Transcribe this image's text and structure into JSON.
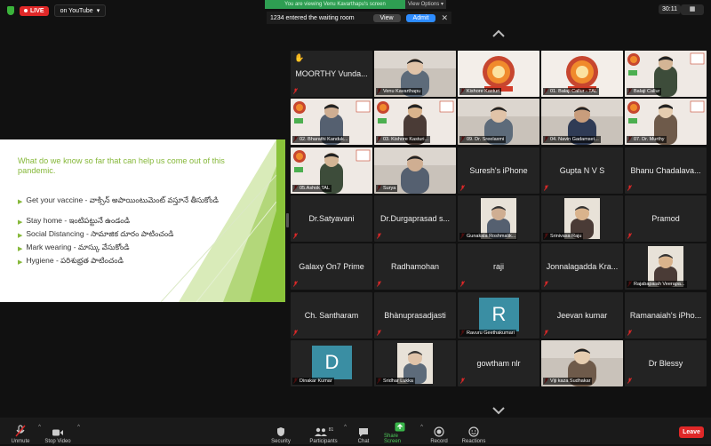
{
  "header": {
    "live_label": "LIVE",
    "youtube_label": "on YouTube",
    "viewing_banner": "You are viewing Venu Kavarthapu's screen",
    "view_options": "View Options",
    "timer": "30:11",
    "waiting": {
      "text": "1234 entered the waiting room",
      "view_label": "View",
      "admit_label": "Admit"
    }
  },
  "slide": {
    "title": "What do we know so far that can help us come out of this pandemic.",
    "items": [
      "Get your vaccine - వాక్సిన్ అపాయింటుమెంట్ వస్తూనే తీసుకోండి",
      "Stay home - ఇంటిపట్టునే ఉండండి",
      "Social Distancing - సామాజిక దూరం పాటించండి",
      "Mark wearing - మాస్కు వేసుకోండి",
      "Hygiene - పరిశుభ్రత పాటించండి"
    ]
  },
  "participants": [
    {
      "name": "MOORTHY Vunda...",
      "kind": "name",
      "hand": true
    },
    {
      "name": "Venu Kavarthapu",
      "kind": "video"
    },
    {
      "name": "Kishore Kasturi",
      "kind": "logo"
    },
    {
      "name": "01. Balaji Callur - TAL",
      "kind": "logo"
    },
    {
      "name": "Balaji Callur",
      "kind": "video"
    },
    {
      "name": "02. Bharathi Kanduk...",
      "kind": "video"
    },
    {
      "name": "03. Kishore Kasturi...",
      "kind": "video"
    },
    {
      "name": "09. Dr. Sreelaxmi",
      "kind": "video"
    },
    {
      "name": "04. Navin Gadamset...",
      "kind": "video"
    },
    {
      "name": "07. Dr. Murthy",
      "kind": "video"
    },
    {
      "name": "05.Ashok TAL",
      "kind": "video"
    },
    {
      "name": "Surya",
      "kind": "video"
    },
    {
      "name": "Suresh's iPhone",
      "kind": "name"
    },
    {
      "name": "Gupta N V S",
      "kind": "name"
    },
    {
      "name": "Bhanu Chadalava...",
      "kind": "name"
    },
    {
      "name": "Dr.Satyavani",
      "kind": "name"
    },
    {
      "name": "Dr.Durgaprasad s...",
      "kind": "name"
    },
    {
      "name": "Gunakala Roshmalik...",
      "kind": "photo"
    },
    {
      "name": "Srinivasa Raju",
      "kind": "photo"
    },
    {
      "name": "Pramod",
      "kind": "name"
    },
    {
      "name": "Galaxy On7 Prime",
      "kind": "name"
    },
    {
      "name": "Radhamohan",
      "kind": "name"
    },
    {
      "name": "raji",
      "kind": "name"
    },
    {
      "name": "Jonnalagadda Kra...",
      "kind": "name"
    },
    {
      "name": "Rajabapaiah Veerapa...",
      "kind": "photo"
    },
    {
      "name": "Ch. Santharam",
      "kind": "name"
    },
    {
      "name": "Bhànuprasadjasti",
      "kind": "name"
    },
    {
      "name": "Ravuru Geethakumari",
      "kind": "initial",
      "initial": "R"
    },
    {
      "name": "Jeevan kumar",
      "kind": "name"
    },
    {
      "name": "Ramanaiah's iPho...",
      "kind": "name"
    },
    {
      "name": "Dinakar Kumar",
      "kind": "initial",
      "initial": "D"
    },
    {
      "name": "Sridhar Lukka",
      "kind": "photo"
    },
    {
      "name": "gowtham nlr",
      "kind": "name"
    },
    {
      "name": "Viji kaza Sudhakar",
      "kind": "video"
    },
    {
      "name": "Dr Blessy",
      "kind": "name"
    }
  ],
  "toolbar": {
    "unmute": "Unmute",
    "stop_video": "Stop Video",
    "security": "Security",
    "participants": "Participants",
    "participants_count": "81",
    "chat": "Chat",
    "share_screen": "Share Screen",
    "record": "Record",
    "reactions": "Reactions",
    "leave": "Leave"
  }
}
